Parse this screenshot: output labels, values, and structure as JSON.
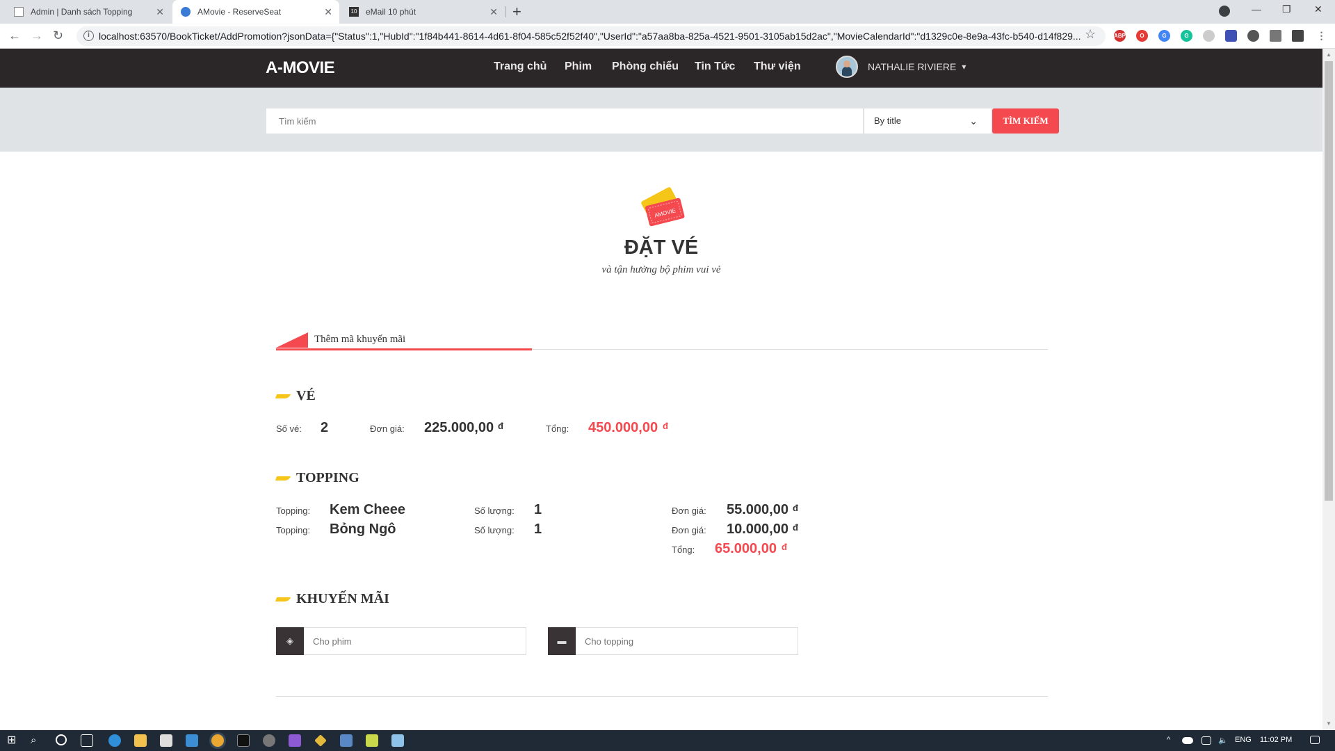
{
  "browser": {
    "tabs": [
      {
        "title": "Admin | Danh sách Topping",
        "icon": "document-icon"
      },
      {
        "title": "AMovie - ReserveSeat",
        "icon": "amovie-icon"
      },
      {
        "title": "eMail 10 phút",
        "icon": "10-minute-mail-icon"
      }
    ],
    "url": "localhost:63570/BookTicket/AddPromotion?jsonData={\"Status\":1,\"HubId\":\"1f84b441-8614-4d61-8f04-585c52f52f40\",\"UserId\":\"a57aa8ba-825a-4521-9501-3105ab15d2ac\",\"MovieCalendarId\":\"d1329c0e-8e9a-43fc-b540-d14f829..."
  },
  "header": {
    "logo": "A-MOVIE",
    "nav": [
      "Trang chủ",
      "Phim",
      "Phòng chiếu",
      "Tin Tức",
      "Thư viện"
    ],
    "user_name": "NATHALIE RIVIERE"
  },
  "search": {
    "placeholder": "Tìm kiếm",
    "mode": "By title",
    "button": "TÌM KIẾM"
  },
  "page": {
    "ticket_badge": "AMOVIE",
    "title": "ĐẶT VÉ",
    "subtitle": "và tận hưởng bộ phim vui vẻ",
    "promo_tab": "Thêm mã khuyến mãi"
  },
  "ticket": {
    "heading": "VÉ",
    "count_label": "Số vé:",
    "count": "2",
    "price_label": "Đơn giá:",
    "price": "225.000,00",
    "total_label": "Tổng:",
    "total": "450.000,00",
    "currency": "đ"
  },
  "topping": {
    "heading": "TOPPING",
    "items": [
      {
        "label": "Topping:",
        "name": "Kem Cheee",
        "qty_label": "Số lượng:",
        "qty": "1",
        "price_label": "Đơn giá:",
        "price": "55.000,00"
      },
      {
        "label": "Topping:",
        "name": "Bỏng Ngô",
        "qty_label": "Số lượng:",
        "qty": "1",
        "price_label": "Đơn giá:",
        "price": "10.000,00"
      }
    ],
    "total_label": "Tổng:",
    "total": "65.000,00",
    "currency": "đ"
  },
  "promotion": {
    "heading": "KHUYẾN MÃI",
    "movie_placeholder": "Cho phim",
    "topping_placeholder": "Cho topping"
  },
  "taskbar": {
    "lang": "ENG",
    "time": "11:02 PM"
  },
  "colors": {
    "accent": "#f4494f",
    "header_bg": "#2b2627",
    "section_mark": "#f5c518"
  }
}
